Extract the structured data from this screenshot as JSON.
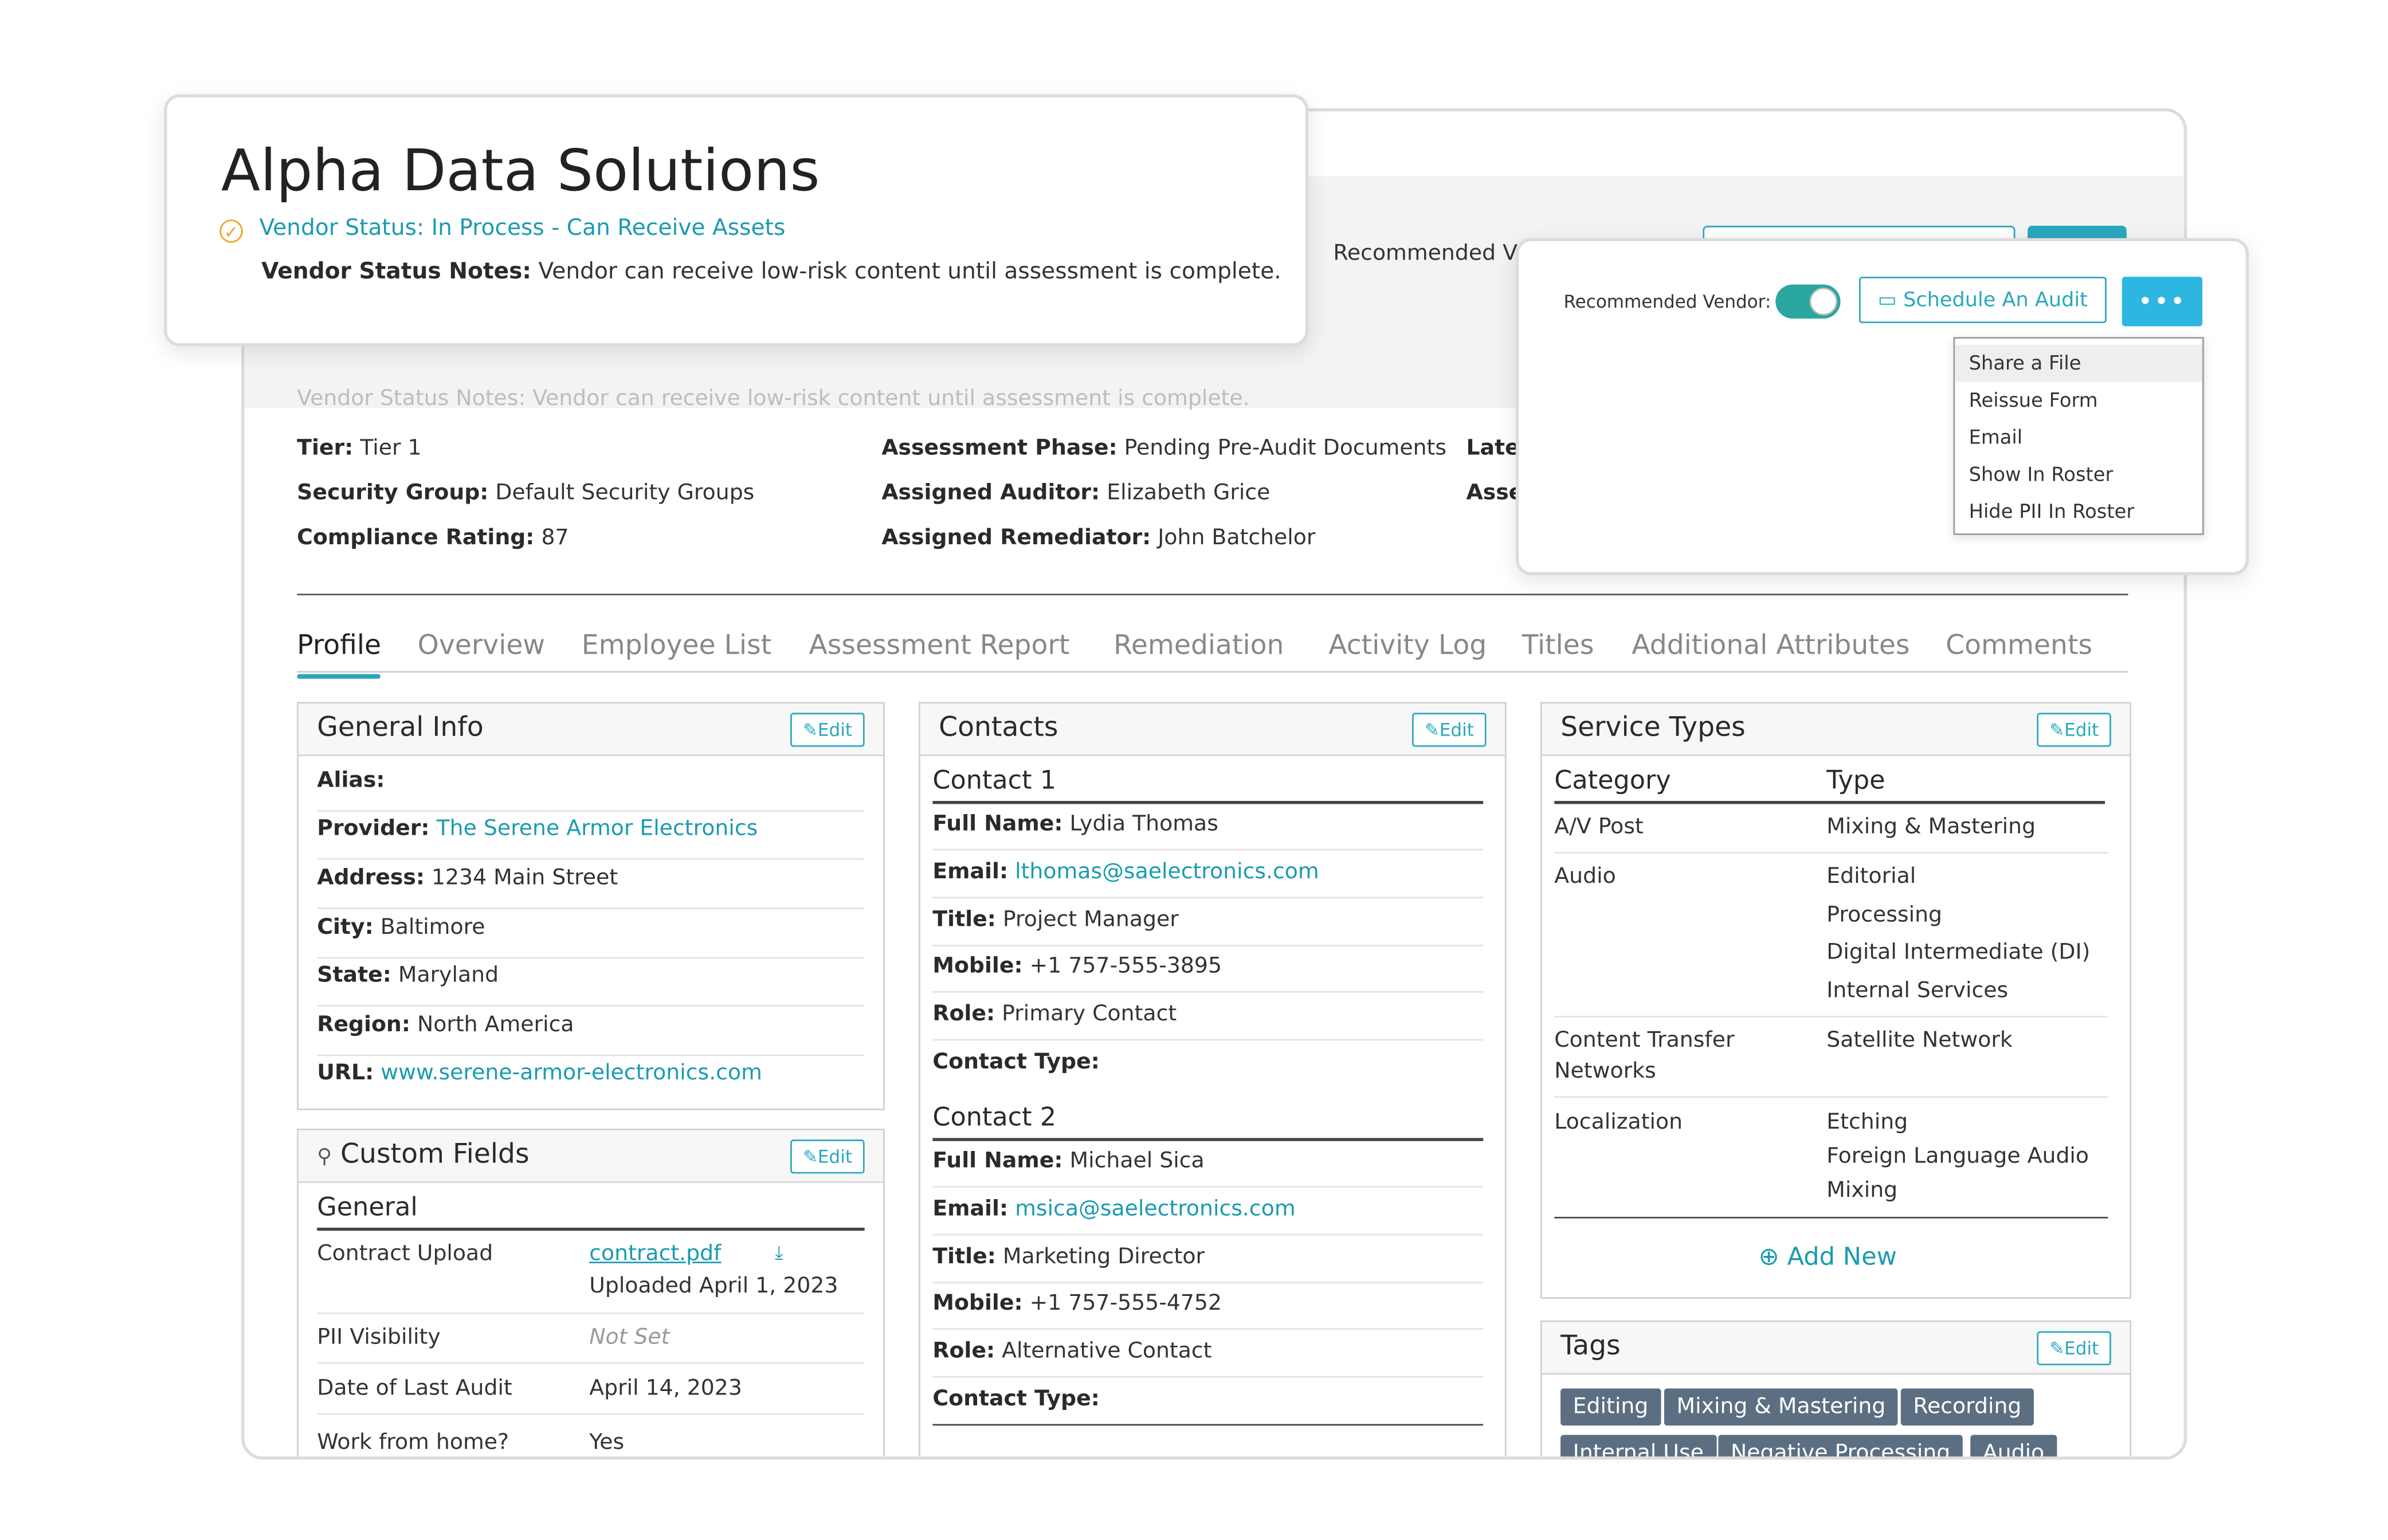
{
  "vendor": {
    "name": "Alpha Data Solutions",
    "status": "Vendor Status: In Process - Can Receive Assets",
    "status_notes_label": "Vendor Status Notes:",
    "status_notes": "Vendor can receive low-risk content until assessment is complete.",
    "status_notes_ghost": "Vendor Status Notes: Vendor can receive low-risk content until assessment is complete."
  },
  "header": {
    "recommended_ghost": "Recommended V"
  },
  "meta": {
    "col1": [
      {
        "label": "Tier:",
        "value": "Tier 1"
      },
      {
        "label": "Security Group:",
        "value": "Default Security Groups"
      },
      {
        "label": "Compliance Rating:",
        "value": "87"
      }
    ],
    "col2": [
      {
        "label": "Assessment Phase:",
        "value": "Pending Pre-Audit Documents"
      },
      {
        "label": "Assigned Auditor:",
        "value": "Elizabeth Grice"
      },
      {
        "label": "Assigned Remediator:",
        "value": "John Batchelor"
      }
    ],
    "col3": [
      {
        "label": "Late",
        "value": ""
      },
      {
        "label": "Asse",
        "value": ""
      }
    ]
  },
  "tabs": [
    "Profile",
    "Overview",
    "Employee List",
    "Assessment Report",
    "Remediation",
    "Activity Log",
    "Titles",
    "Additional Attributes",
    "Comments"
  ],
  "general_info": {
    "title": "General Info",
    "edit": "Edit",
    "rows": [
      {
        "label": "Alias:",
        "value": ""
      },
      {
        "label": "Provider:",
        "value": "The Serene Armor Electronics"
      },
      {
        "label": "Address:",
        "value": "1234 Main Street"
      },
      {
        "label": "City:",
        "value": "Baltimore"
      },
      {
        "label": "State:",
        "value": "Maryland"
      },
      {
        "label": "Region:",
        "value": "North America"
      },
      {
        "label": "URL:",
        "value": "www.serene-armor-electronics.com"
      }
    ]
  },
  "custom_fields": {
    "title": "Custom Fields",
    "edit": "Edit",
    "group": "General",
    "rows": [
      {
        "label": "Contract Upload",
        "value": "contract.pdf",
        "sub": "Uploaded April 1, 2023"
      },
      {
        "label": "PII Visibility",
        "value": "Not Set"
      },
      {
        "label": "Date of Last Audit",
        "value": "April 14, 2023"
      },
      {
        "label": "Work from home?",
        "value": "Yes"
      }
    ]
  },
  "contacts": {
    "title": "Contacts",
    "edit": "Edit",
    "list": [
      {
        "heading": "Contact 1",
        "full_name": "Lydia Thomas",
        "email": "lthomas@saelectronics.com",
        "title": "Project Manager",
        "mobile": "+1 757-555-3895",
        "role": "Primary Contact",
        "type": ""
      },
      {
        "heading": "Contact 2",
        "full_name": "Michael Sica",
        "email": "msica@saelectronics.com",
        "title": "Marketing Director",
        "mobile": "+1 757-555-4752",
        "role": "Alternative Contact",
        "type": ""
      }
    ],
    "labels": {
      "full_name": "Full Name:",
      "email": "Email:",
      "title": "Title:",
      "mobile": "Mobile:",
      "role": "Role:",
      "type": "Contact Type:"
    }
  },
  "service_types": {
    "title": "Service Types",
    "edit": "Edit",
    "col_category": "Category",
    "col_type": "Type",
    "rows": [
      {
        "category": "A/V Post",
        "types": [
          "Mixing & Mastering"
        ]
      },
      {
        "category": "Audio",
        "types": [
          "Editorial",
          "Processing",
          "Digital Intermediate (DI)",
          "Internal Services"
        ]
      },
      {
        "category": "Content Transfer Networks",
        "types": [
          "Satellite Network"
        ]
      },
      {
        "category": "Localization",
        "types": [
          "Etching",
          "Foreign Language Audio Mixing"
        ]
      }
    ],
    "add_new": "Add New"
  },
  "tags": {
    "title": "Tags",
    "edit": "Edit",
    "items": [
      "Editing",
      "Mixing & Mastering",
      "Recording",
      "Internal Use",
      "Negative Processing",
      "Audio"
    ]
  },
  "actions_popup": {
    "recommended_label": "Recommended Vendor:",
    "recommended_on": true,
    "schedule_audit": "Schedule An Audit",
    "more": "•••",
    "menu": [
      "Share a File",
      "Reissue Form",
      "Email",
      "Show In Roster",
      "Hide PII In Roster"
    ]
  },
  "colors": {
    "accent": "#2aa7be",
    "link": "#1a9bb0",
    "tag_bg": "#5c6e82",
    "status_icon": "#f0a020"
  }
}
